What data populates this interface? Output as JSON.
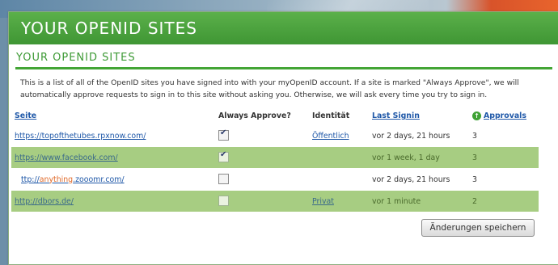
{
  "header": {
    "title": "YOUR OPENID SITES"
  },
  "section": {
    "title": "YOUR OPENID SITES",
    "intro": "This is a list of all of the OpenID sites you have signed into with your myOpenID account. If a site is marked \"Always Approve\", we will automatically approve requests to sign in to this site without asking you. Otherwise, we will ask every time you try to sign in."
  },
  "table": {
    "columns": {
      "site": "Seite",
      "always_approve": "Always Approve?",
      "identity": "Identität",
      "last_signin": "Last Signin",
      "approvals": "Approvals"
    },
    "rows": [
      {
        "url": "https://topofthetubes.rpxnow.com/",
        "always_approve": true,
        "identity": "Öffentlich",
        "last_signin": "vor 2 days, 21 hours",
        "approvals": "3"
      },
      {
        "url": "https://www.facebook.com/",
        "always_approve": true,
        "identity": "",
        "last_signin": "vor 1 week, 1 day",
        "approvals": "3"
      },
      {
        "url_prefix": "ttp://",
        "url_highlight": "anything",
        "url_suffix": ".zooomr.com/",
        "always_approve": false,
        "identity": "",
        "last_signin": "vor 2 days, 21 hours",
        "approvals": "3"
      },
      {
        "url": "http://dbors.de/",
        "always_approve": false,
        "identity": "Privat",
        "last_signin": "vor 1 minute",
        "approvals": "2"
      }
    ]
  },
  "save_button": {
    "label": "Änderungen speichern"
  },
  "icons": {
    "approvals_column": "info-icon",
    "checkbox_checked": "check-icon"
  },
  "colors": {
    "header_green": "#4ea540",
    "row_green": "#a7cd82",
    "link_blue": "#1f58a8"
  }
}
